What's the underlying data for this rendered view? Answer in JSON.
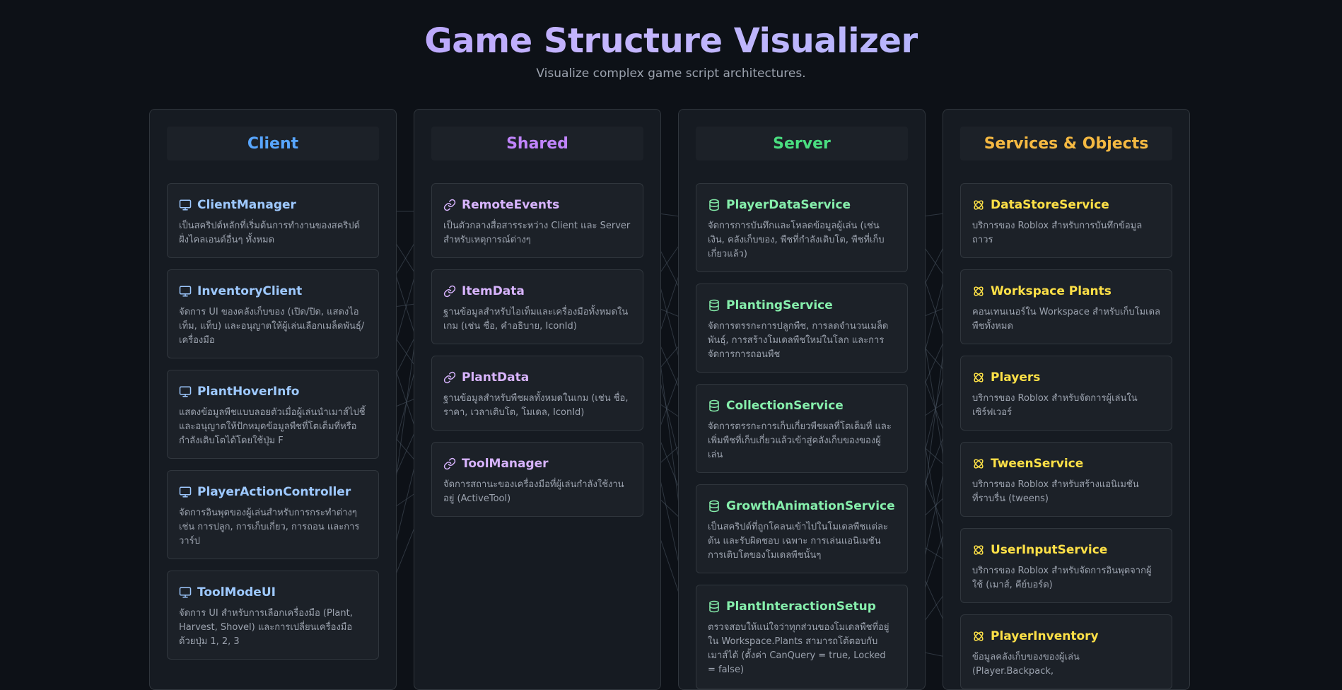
{
  "header": {
    "title": "Game Structure Visualizer",
    "subtitle": "Visualize complex game script architectures."
  },
  "columns": [
    {
      "key": "client",
      "title": "Client",
      "color": "#58a6ff",
      "card_title_color": "#9ec9ff",
      "icon": "monitor-icon",
      "cards": [
        {
          "name": "ClientManager",
          "desc": "เป็นสคริปต์หลักที่เริ่มต้นการทำงานของสคริปต์ฝั่งไคลเอนต์อื่นๆ ทั้งหมด"
        },
        {
          "name": "InventoryClient",
          "desc": "จัดการ UI ของคลังเก็บของ (เปิด/ปิด, แสดงไอเท็ม, แท็บ) และอนุญาตให้ผู้เล่นเลือกเมล็ดพันธุ์/เครื่องมือ"
        },
        {
          "name": "PlantHoverInfo",
          "desc": "แสดงข้อมูลพืชแบบลอยตัวเมื่อผู้เล่นนำเมาส์ไปชี้ และอนุญาตให้ปักหมุดข้อมูลพืชที่โตเต็มที่หรือกำลังเติบโตได้โดยใช้ปุ่ม F"
        },
        {
          "name": "PlayerActionController",
          "desc": "จัดการอินพุตของผู้เล่นสำหรับการกระทำต่างๆ เช่น การปลูก, การเก็บเกี่ยว, การถอน และการวาร์ป"
        },
        {
          "name": "ToolModeUI",
          "desc": "จัดการ UI สำหรับการเลือกเครื่องมือ (Plant, Harvest, Shovel) และการเปลี่ยนเครื่องมือด้วยปุ่ม 1, 2, 3"
        }
      ]
    },
    {
      "key": "shared",
      "title": "Shared",
      "color": "#c084fc",
      "card_title_color": "#d8b4fe",
      "icon": "link-icon",
      "cards": [
        {
          "name": "RemoteEvents",
          "desc": "เป็นตัวกลางสื่อสารระหว่าง Client และ Server สำหรับเหตุการณ์ต่างๆ"
        },
        {
          "name": "ItemData",
          "desc": "ฐานข้อมูลสำหรับไอเท็มและเครื่องมือทั้งหมดในเกม (เช่น ชื่อ, คำอธิบาย, IconId)"
        },
        {
          "name": "PlantData",
          "desc": "ฐานข้อมูลสำหรับพืชผลทั้งหมดในเกม (เช่น ชื่อ, ราคา, เวลาเติบโต, โมเดล, IconId)"
        },
        {
          "name": "ToolManager",
          "desc": "จัดการสถานะของเครื่องมือที่ผู้เล่นกำลังใช้งานอยู่ (ActiveTool)"
        }
      ]
    },
    {
      "key": "server",
      "title": "Server",
      "color": "#4ade80",
      "card_title_color": "#86efac",
      "icon": "database-icon",
      "cards": [
        {
          "name": "PlayerDataService",
          "desc": "จัดการการบันทึกและโหลดข้อมูลผู้เล่น (เช่น เงิน, คลังเก็บของ, พืชที่กำลังเติบโต, พืชที่เก็บเกี่ยวแล้ว)"
        },
        {
          "name": "PlantingService",
          "desc": "จัดการตรรกะการปลูกพืช, การลดจำนวนเมล็ดพันธุ์, การสร้างโมเดลพืชใหม่ในโลก และการจัดการการถอนพืช"
        },
        {
          "name": "CollectionService",
          "desc": "จัดการตรรกะการเก็บเกี่ยวพืชผลที่โตเต็มที่ และเพิ่มพืชที่เก็บเกี่ยวแล้วเข้าสู่คลังเก็บของของผู้เล่น"
        },
        {
          "name": "GrowthAnimationService",
          "desc": "เป็นสคริปต์ที่ถูกโคลนเข้าไปในโมเดลพืชแต่ละต้น และรับผิดชอบ เฉพาะ การเล่นแอนิเมชันการเติบโตของโมเดลพืชนั้นๆ"
        },
        {
          "name": "PlantInteractionSetup",
          "desc": "ตรวจสอบให้แน่ใจว่าทุกส่วนของโมเดลพืชที่อยู่ใน Workspace.Plants สามารถโต้ตอบกับเมาส์ได้ (ตั้งค่า CanQuery = true, Locked = false)"
        }
      ]
    },
    {
      "key": "services",
      "title": "Services & Objects",
      "color": "#f5b942",
      "card_title_color": "#fde047",
      "icon": "orbit-icon",
      "cards": [
        {
          "name": "DataStoreService",
          "desc": "บริการของ Roblox สำหรับการบันทึกข้อมูลถาวร"
        },
        {
          "name": "Workspace Plants",
          "desc": "คอนเทนเนอร์ใน Workspace สำหรับเก็บโมเดลพืชทั้งหมด"
        },
        {
          "name": "Players",
          "desc": "บริการของ Roblox สำหรับจัดการผู้เล่นในเซิร์ฟเวอร์"
        },
        {
          "name": "TweenService",
          "desc": "บริการของ Roblox สำหรับสร้างแอนิเมชันที่ราบรื่น (tweens)"
        },
        {
          "name": "UserInputService",
          "desc": "บริการของ Roblox สำหรับจัดการอินพุตจากผู้ใช้ (เมาส์, คีย์บอร์ด)"
        },
        {
          "name": "PlayerInventory",
          "desc": "ข้อมูลคลังเก็บของของผู้เล่น (Player.Backpack,"
        }
      ]
    }
  ]
}
